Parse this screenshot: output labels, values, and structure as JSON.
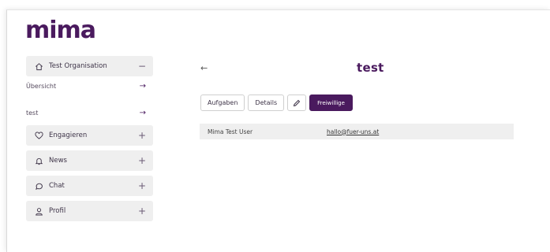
{
  "brand": {
    "logo_text": "mima",
    "accent": "#4a1a5e"
  },
  "sidebar": {
    "organisation": {
      "label": "Test Organisation",
      "icon": "home-icon",
      "toggle": "−"
    },
    "sub_items": [
      {
        "label": "Übersicht",
        "arrow": "→"
      },
      {
        "label": "test",
        "arrow": "→"
      }
    ],
    "items": [
      {
        "label": "Engagieren",
        "icon": "heart-icon",
        "toggle": "+"
      },
      {
        "label": "News",
        "icon": "bell-icon",
        "toggle": "+"
      },
      {
        "label": "Chat",
        "icon": "chat-bubble-icon",
        "toggle": "+"
      },
      {
        "label": "Profil",
        "icon": "user-icon",
        "toggle": "+"
      }
    ]
  },
  "main": {
    "back": "←",
    "title": "test",
    "tabs": [
      {
        "label": "Aufgaben",
        "active": false
      },
      {
        "label": "Details",
        "active": false
      },
      {
        "label": "",
        "icon": "pencil-icon",
        "active": false
      },
      {
        "label": "Freiwillige",
        "active": true
      }
    ],
    "volunteers": [
      {
        "name": "Mima Test User",
        "email": "hallo@fuer-uns.at"
      }
    ]
  }
}
